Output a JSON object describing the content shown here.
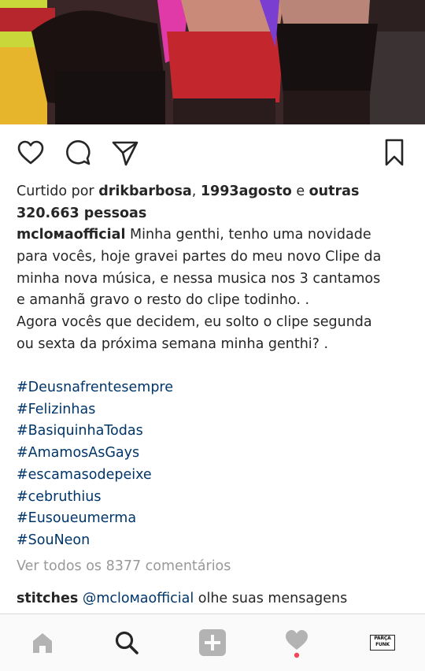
{
  "post": {
    "photo_alt": "Three performers in fringed skirts",
    "liked_by_prefix": "Curtido por ",
    "liked_user_1": "drikbarbosa",
    "liked_sep": ", ",
    "liked_user_2": "1993agosto",
    "liked_and": " e ",
    "liked_others": "outras 320.663 pessoas",
    "caption_user": "mcloмaofficial",
    "caption_lines": [
      "Minha genthi, tenho uma novidade",
      "para vocês, hoje gravei partes do meu novo Clipe da",
      "minha nova música, e nessa musica nos 3 cantamos",
      "e amanhã gravo o resto do clipe todinho. .",
      "Agora vocês que decidem, eu solto o clipe segunda",
      "ou sexta da próxima semana minha genthi? ."
    ],
    "hashtags": [
      "#Deusnafrentesempre",
      "#Felizinhas",
      "#BasiquinhaTodas",
      "#AmamosAsGays",
      "#escamasodepeixe",
      "#cebruthius",
      "#Eusoueumerma",
      "#SouNeon"
    ],
    "view_all_comments": "Ver todos os 8377 comentários",
    "comment_user": "stitches",
    "comment_mention": "@mcloмaofficial",
    "comment_text": " olhe suas mensagens"
  },
  "actions": {
    "like_icon": "heart-outline-icon",
    "comment_icon": "speech-bubble-icon",
    "share_icon": "paper-plane-icon",
    "save_icon": "bookmark-icon"
  },
  "nav": {
    "home_icon": "home-icon",
    "search_icon": "search-icon",
    "add_icon": "add-post-icon",
    "activity_icon": "heart-icon",
    "profile_badge": "PARÇA FUNK",
    "notification_color": "#ed4956"
  }
}
